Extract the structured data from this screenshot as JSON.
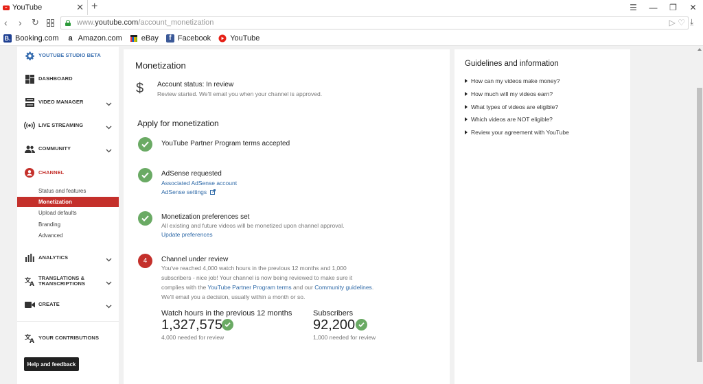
{
  "browser": {
    "tab_title": "YouTube",
    "tab_close": "✕",
    "new_tab": "+",
    "url_prefix": "www.",
    "url_host": "youtube.com",
    "url_path": "/account_monetization",
    "bookmarks": [
      {
        "label": "Booking.com",
        "icon": "booking-icon",
        "glyph": "B.",
        "color": "#1d3f91"
      },
      {
        "label": "Amazon.com",
        "icon": "amazon-icon",
        "glyph": "a",
        "color": "#ffffff"
      },
      {
        "label": "eBay",
        "icon": "ebay-icon",
        "glyph": "",
        "color": "#e53238"
      },
      {
        "label": "Facebook",
        "icon": "facebook-icon",
        "glyph": "f",
        "color": "#3b5998"
      },
      {
        "label": "YouTube",
        "icon": "youtube-icon",
        "glyph": "",
        "color": "#e62117"
      }
    ]
  },
  "sidebar": {
    "studio_label": "YOUTUBE STUDIO BETA",
    "items": {
      "dashboard": "DASHBOARD",
      "video_manager": "VIDEO MANAGER",
      "live_streaming": "LIVE STREAMING",
      "community": "COMMUNITY",
      "channel": "CHANNEL",
      "analytics": "ANALYTICS",
      "translations": "TRANSLATIONS & TRANSCRIPTIONS",
      "create": "CREATE",
      "your_contributions": "YOUR CONTRIBUTIONS"
    },
    "channel_sub": {
      "status": "Status and features",
      "monetization": "Monetization",
      "upload_defaults": "Upload defaults",
      "branding": "Branding",
      "advanced": "Advanced"
    },
    "help_button": "Help and feedback",
    "accent_color": "#c4302b"
  },
  "main": {
    "title": "Monetization",
    "account_status": "Account status: In review",
    "account_status_note": "Review started. We'll email you when your channel is approved.",
    "apply_heading": "Apply for monetization",
    "steps": {
      "terms": "YouTube Partner Program terms accepted",
      "adsense": "AdSense requested",
      "adsense_link1": "Associated AdSense account",
      "adsense_link2": "AdSense settings",
      "prefs": "Monetization preferences set",
      "prefs_note": "All existing and future videos will be monetized upon channel approval.",
      "prefs_link": "Update preferences",
      "review_number": "4",
      "review": "Channel under review",
      "review_line1": "You've reached 4,000 watch hours in the previous 12 months and 1,000",
      "review_line2": "subscribers - nice job! Your channel is now being reviewed to make sure it",
      "review_line3a": "complies with the ",
      "review_link_ypp": "YouTube Partner Program terms",
      "review_line3b": " and our ",
      "review_link_cg": "Community guidelines",
      "review_line3c": ".",
      "review_line4": "We'll email you a decision, usually within a month or so."
    },
    "stats": {
      "watch_label": "Watch hours in the previous 12 months",
      "watch_value": "1,327,575",
      "watch_needed": "4,000 needed for review",
      "subs_label": "Subscribers",
      "subs_value": "92,200",
      "subs_needed": "1,000 needed for review"
    },
    "success_color": "#6aaa64"
  },
  "guidelines": {
    "title": "Guidelines and information",
    "items": [
      "How can my videos make money?",
      "How much will my videos earn?",
      "What types of videos are eligible?",
      "Which videos are NOT eligible?",
      "Review your agreement with YouTube"
    ]
  }
}
